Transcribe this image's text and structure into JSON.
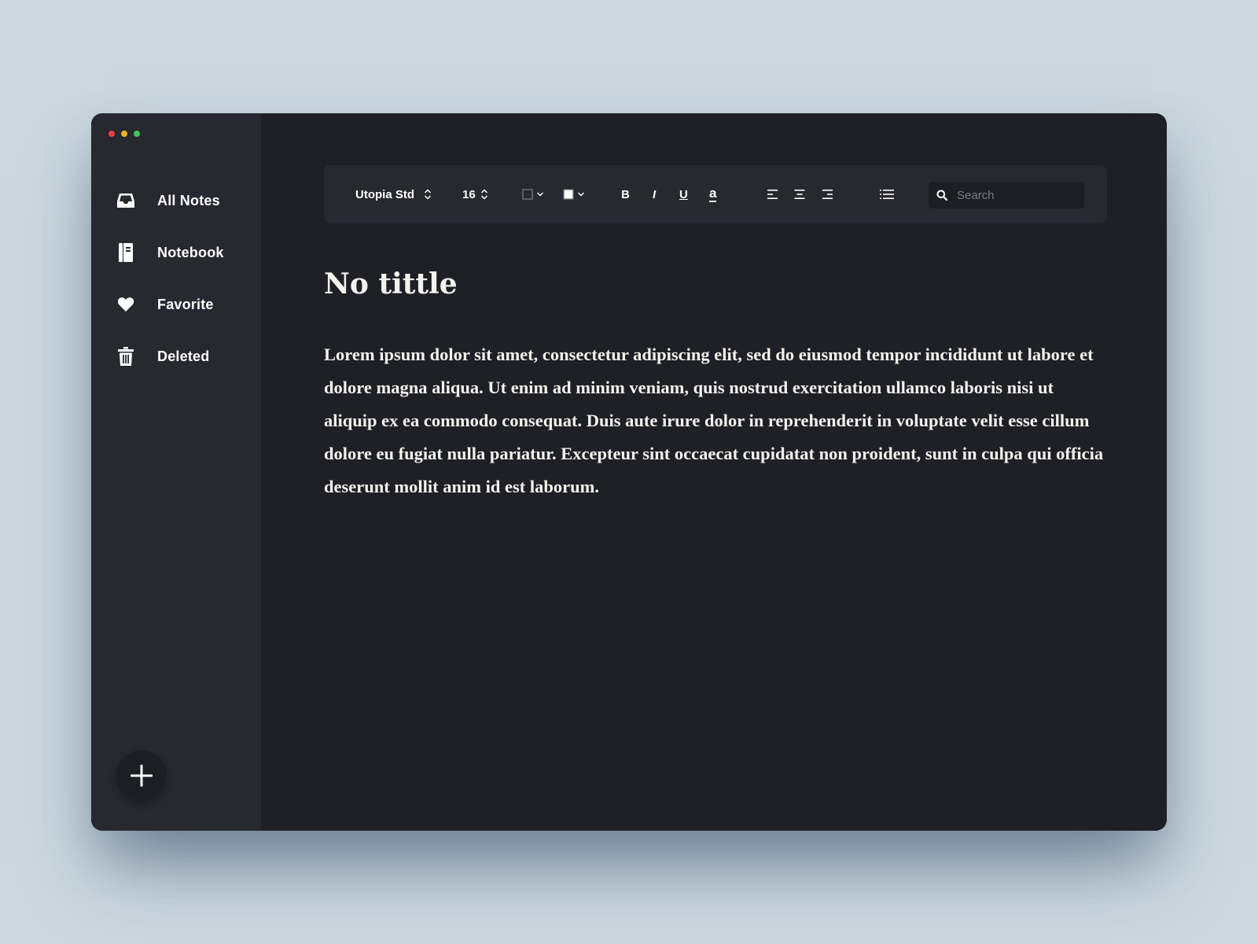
{
  "window": {
    "traffic_lights": [
      "#e5453a",
      "#e8b52b",
      "#3ec55a"
    ]
  },
  "sidebar": {
    "items": [
      {
        "label": "All Notes",
        "icon": "inbox-icon"
      },
      {
        "label": "Notebook",
        "icon": "notebook-icon"
      },
      {
        "label": "Favorite",
        "icon": "heart-icon"
      },
      {
        "label": "Deleted",
        "icon": "trash-icon"
      }
    ],
    "add_icon": "plus-icon"
  },
  "toolbar": {
    "font_family": "Utopia Std",
    "font_size": "16",
    "border_color_icon": "border-color-swatch-icon",
    "fill_color_icon": "fill-color-swatch-icon",
    "bold_label": "B",
    "italic_label": "I",
    "underline_label": "U",
    "text_color_label": "a",
    "align_left_icon": "align-left-icon",
    "align_center_icon": "align-center-icon",
    "align_right_icon": "align-right-icon",
    "list_icon": "bulleted-list-icon",
    "search_placeholder": "Search",
    "search_icon": "search-icon"
  },
  "note": {
    "title": "No tittle",
    "body": "Lorem ipsum dolor sit amet, consectetur adipiscing elit, sed do eiusmod tempor incididunt ut labore et dolore magna aliqua. Ut enim ad minim veniam, quis nostrud exercitation ullamco laboris nisi ut aliquip ex ea commodo consequat. Duis aute irure dolor in reprehenderit in voluptate velit esse cillum dolore eu fugiat nulla pariatur. Excepteur sint occaecat cupidatat non proident, sunt in culpa qui officia deserunt mollit anim id est laborum."
  },
  "colors": {
    "sidebar_bg": "#272830",
    "main_bg": "#1f2026",
    "text": "#ffffff"
  }
}
